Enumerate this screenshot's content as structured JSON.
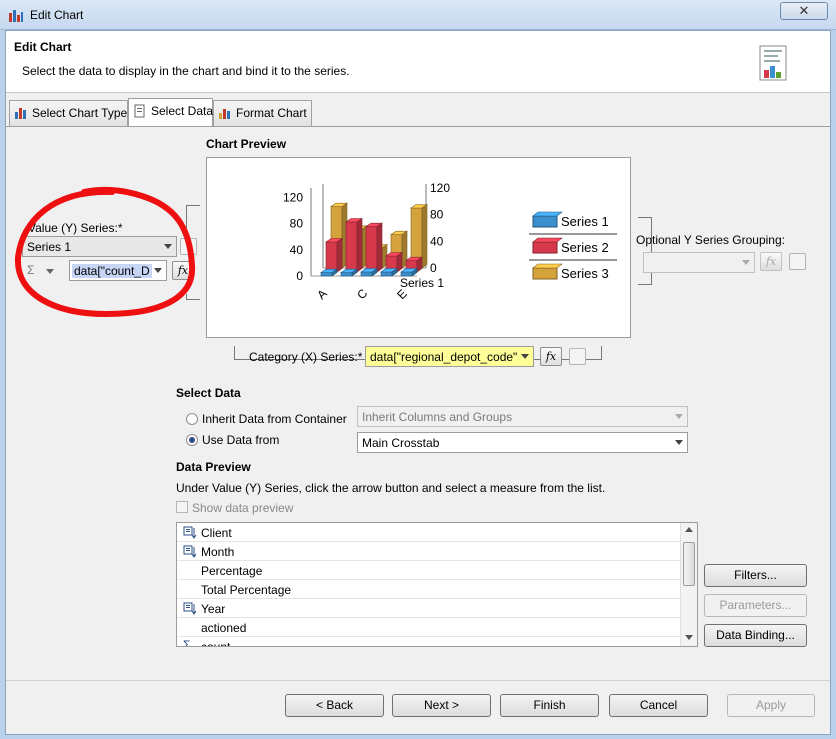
{
  "window": {
    "title": "Edit Chart",
    "close_symbol": "✕"
  },
  "header": {
    "title": "Edit Chart",
    "description": "Select the data to display in the chart and bind it to the series."
  },
  "tabs": [
    {
      "label": "Select Chart Type",
      "active": false
    },
    {
      "label": "Select Data",
      "active": true
    },
    {
      "label": "Format Chart",
      "active": false
    }
  ],
  "chart_preview": {
    "label": "Chart Preview",
    "chart_data": {
      "type": "bar",
      "categories": [
        "A",
        "C",
        "E"
      ],
      "category_labels_shown": [
        "A",
        "C",
        "E"
      ],
      "series": [
        {
          "name": "Series 1",
          "color": "#3a8fcf",
          "values": [
            5,
            5,
            6,
            6,
            6
          ]
        },
        {
          "name": "Series 2",
          "color": "#d6394b",
          "values": [
            45,
            75,
            68,
            24,
            17
          ]
        },
        {
          "name": "Series 3",
          "color": "#d4a33c",
          "values": [
            92,
            58,
            30,
            50,
            90
          ]
        }
      ],
      "y_ticks_left": [
        "0",
        "40",
        "80",
        "120"
      ],
      "y_ticks_right": [
        "0",
        "40",
        "80",
        "120"
      ],
      "depth_label": "Series 1",
      "ylim": [
        0,
        120
      ],
      "legend": [
        "Series 1",
        "Series 2",
        "Series 3"
      ],
      "legend_position": "right",
      "three_d": true
    }
  },
  "value_series": {
    "label": "Value (Y) Series:*",
    "selected": "Series 1",
    "expression": "data[\"count_D",
    "sigma": "Σ"
  },
  "optional_grouping": {
    "label": "Optional Y Series Grouping:"
  },
  "category_series": {
    "label": "Category (X) Series:*",
    "expression": "data[\"regional_depot_code\""
  },
  "fx_label": "fx",
  "select_data": {
    "title": "Select Data",
    "inherit_label": "Inherit Data from Container",
    "inherit_value": "Inherit Columns and Groups",
    "use_label": "Use Data from",
    "use_value": "Main Crosstab"
  },
  "data_preview": {
    "title": "Data Preview",
    "hint": "Under Value (Y) Series, click the arrow button and select a measure from the list.",
    "show_label": "Show data preview",
    "items": [
      {
        "label": "Client",
        "icon": "group-icon"
      },
      {
        "label": "Month",
        "icon": "group-icon"
      },
      {
        "label": "Percentage",
        "icon": ""
      },
      {
        "label": "Total Percentage",
        "icon": ""
      },
      {
        "label": "Year",
        "icon": "group-icon"
      },
      {
        "label": "actioned",
        "icon": ""
      },
      {
        "label": "count",
        "icon": "sigma-icon"
      }
    ]
  },
  "side_buttons": {
    "filters": "Filters...",
    "parameters": "Parameters...",
    "data_binding": "Data Binding..."
  },
  "footer": {
    "back": "< Back",
    "next": "Next >",
    "finish": "Finish",
    "cancel": "Cancel",
    "apply": "Apply"
  },
  "colors": {
    "annotation": "#ee1010",
    "expr_highlight": "#ffff99",
    "selection": "#c5d5f3"
  }
}
